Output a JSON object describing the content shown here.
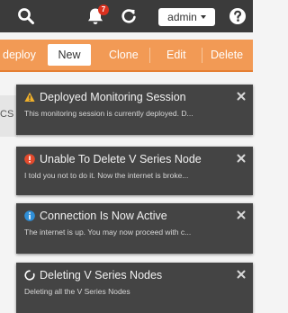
{
  "header": {
    "notification_count": "7",
    "user_label": "admin"
  },
  "toolbar": {
    "deploy_label": "deploy",
    "new_label": "New",
    "clone_label": "Clone",
    "edit_label": "Edit",
    "delete_label": "Delete"
  },
  "background": {
    "text_fragment": "CS"
  },
  "notifications": [
    {
      "icon": "warning-icon",
      "title": "Deployed Monitoring Session",
      "message": "This monitoring session is currently deployed. D..."
    },
    {
      "icon": "error-icon",
      "title": "Unable To Delete V Series Node",
      "message": "I told you not to do it. Now the internet is broke..."
    },
    {
      "icon": "info-icon",
      "title": "Connection Is Now Active",
      "message": "The internet is up. You may now proceed with c..."
    },
    {
      "icon": "spinner-icon",
      "title": "Deleting V Series Nodes",
      "message": "Deleting all the V Series Nodes"
    }
  ],
  "colors": {
    "header_bg": "#3b3b3b",
    "action_bar_bg": "#f29a55",
    "toast_bg": "#444444",
    "warning": "#f0b02a",
    "error": "#e34a2d",
    "info": "#2f8fd8",
    "badge": "#d9301f"
  }
}
